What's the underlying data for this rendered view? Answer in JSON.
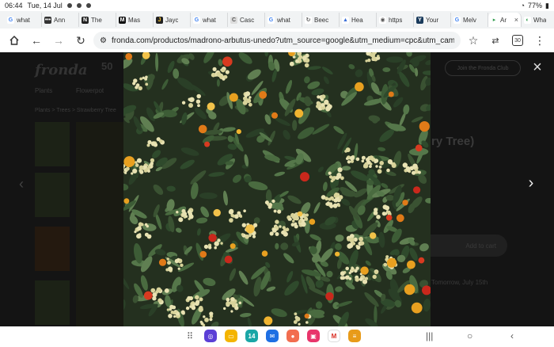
{
  "status": {
    "time": "06:44",
    "date": "Tue, 14 Jul",
    "battery": "77%"
  },
  "tabs": [
    {
      "label": "what",
      "fav": "G",
      "color": "#ffffff",
      "fg": "#4285f4"
    },
    {
      "label": "Ann",
      "fav": "•••",
      "color": "#333333",
      "fg": "#ffffff"
    },
    {
      "label": "The",
      "fav": "N",
      "color": "#222222",
      "fg": "#ffffff"
    },
    {
      "label": "Mas",
      "fav": "M",
      "color": "#111111",
      "fg": "#ffffff"
    },
    {
      "label": "Jayc",
      "fav": "J",
      "color": "#222222",
      "fg": "#f4c430"
    },
    {
      "label": "what",
      "fav": "G",
      "color": "#ffffff",
      "fg": "#4285f4"
    },
    {
      "label": "Casc",
      "fav": "C",
      "color": "#dddddd",
      "fg": "#555555"
    },
    {
      "label": "what",
      "fav": "G",
      "color": "#ffffff",
      "fg": "#4285f4"
    },
    {
      "label": "Beec",
      "fav": "↻",
      "color": "#ffffff",
      "fg": "#555555"
    },
    {
      "label": "Hea",
      "fav": "▲",
      "color": "#ffffff",
      "fg": "#3b6fd8"
    },
    {
      "label": "https",
      "fav": "◉",
      "color": "#ffffff",
      "fg": "#555555"
    },
    {
      "label": "Your",
      "fav": "Y",
      "color": "#1a3b5c",
      "fg": "#ffffff"
    },
    {
      "label": "Melv",
      "fav": "G",
      "color": "#ffffff",
      "fg": "#4285f4"
    },
    {
      "label": "Ar",
      "fav": "▸",
      "color": "#ffffff",
      "fg": "#2f9c4d",
      "active": true
    },
    {
      "label": "Wha",
      "fav": "◐",
      "color": "#ffffff",
      "fg": "#2f9c4d"
    }
  ],
  "toolbar": {
    "url": "fronda.com/productos/madrono-arbutus-unedo?utm_source=google&utm_medium=cpc&utm_campaign=",
    "tab_count": "30"
  },
  "site": {
    "logo": "fronda",
    "anniversary": "50",
    "club_button": "Join the Fronda Club",
    "nav": [
      "Plants",
      "Flowerpot"
    ],
    "breadcrumb": "Plants > Trees > Strawberry Tree",
    "title_fragment": "ry Tree)",
    "cart_button": "Add to cart",
    "delivery": "Tomorrow, July 15th"
  },
  "lightbox": {
    "close": "×",
    "prev": "‹",
    "next": "›"
  },
  "dock": [
    {
      "name": "internet-app",
      "color": "#5b3fd6",
      "glyph": "◎"
    },
    {
      "name": "notes-app",
      "color": "#f4b400",
      "glyph": "▭"
    },
    {
      "name": "calendar-app",
      "color": "#1aa6a6",
      "glyph": "14"
    },
    {
      "name": "messages-app",
      "color": "#1e6fe3",
      "glyph": "✉"
    },
    {
      "name": "contacts-app",
      "color": "#f26d4f",
      "glyph": "●"
    },
    {
      "name": "screen-recorder-app",
      "color": "#e8356b",
      "glyph": "▣"
    },
    {
      "name": "gmail-app",
      "color": "#ffffff",
      "glyph": "M"
    },
    {
      "name": "stack-app",
      "color": "#e89b1a",
      "glyph": "≡"
    }
  ]
}
